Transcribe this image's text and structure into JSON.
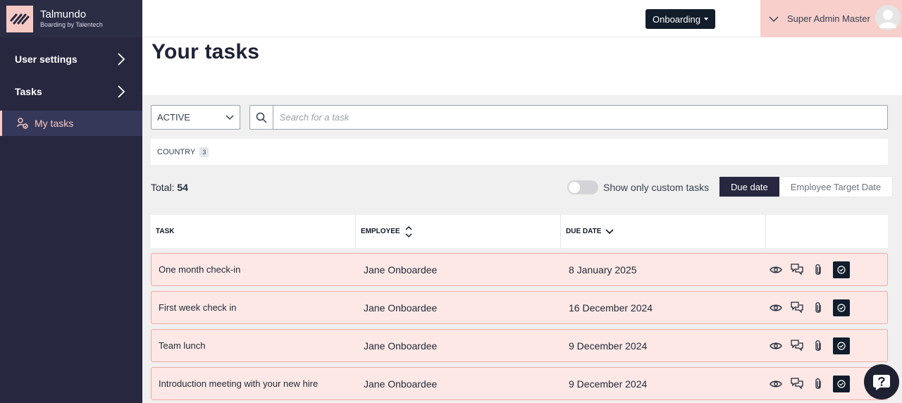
{
  "brand": {
    "name": "Talmundo",
    "subtitle": "Boarding by Talentech"
  },
  "sidebar": {
    "items": [
      {
        "label": "User settings"
      },
      {
        "label": "Tasks"
      }
    ],
    "active_sub": {
      "label": "My tasks"
    }
  },
  "header": {
    "onboarding_label": "Onboarding",
    "user_name": "Super Admin Master"
  },
  "page": {
    "title": "Your tasks"
  },
  "filters": {
    "status_value": "ACTIVE",
    "search_placeholder": "Search for a task",
    "country_label": "COUNTRY",
    "country_count": "3"
  },
  "summary": {
    "total_label": "Total:",
    "total_value": "54",
    "custom_toggle_label": "Show only custom tasks",
    "custom_toggle_on": false,
    "sort_options": [
      "Due date",
      "Employee Target Date"
    ],
    "sort_active": "Due date"
  },
  "table": {
    "headers": {
      "task": "TASK",
      "employee": "EMPLOYEE",
      "due_date": "DUE DATE"
    },
    "rows": [
      {
        "task": "One month check-in",
        "employee": "Jane Onboardee",
        "due": "8 January 2025"
      },
      {
        "task": "First week check in",
        "employee": "Jane Onboardee",
        "due": "16 December 2024"
      },
      {
        "task": "Team lunch",
        "employee": "Jane Onboardee",
        "due": "9 December 2024"
      },
      {
        "task": "Introduction meeting with your new hire",
        "employee": "Jane Onboardee",
        "due": "9 December 2024"
      }
    ]
  },
  "icons": [
    "logo-icon",
    "chevron-right-icon",
    "my-tasks-icon",
    "chevron-down-icon",
    "search-icon",
    "sort-icon",
    "eye-icon",
    "comments-icon",
    "paperclip-icon",
    "check-circle-icon",
    "help-icon"
  ],
  "colors": {
    "sidebar": "#27283f",
    "accent_pink": "#f7c9c4",
    "row_bg": "#fde8e6",
    "row_border": "#f3a9a3",
    "dark_button": "#111d2b"
  }
}
